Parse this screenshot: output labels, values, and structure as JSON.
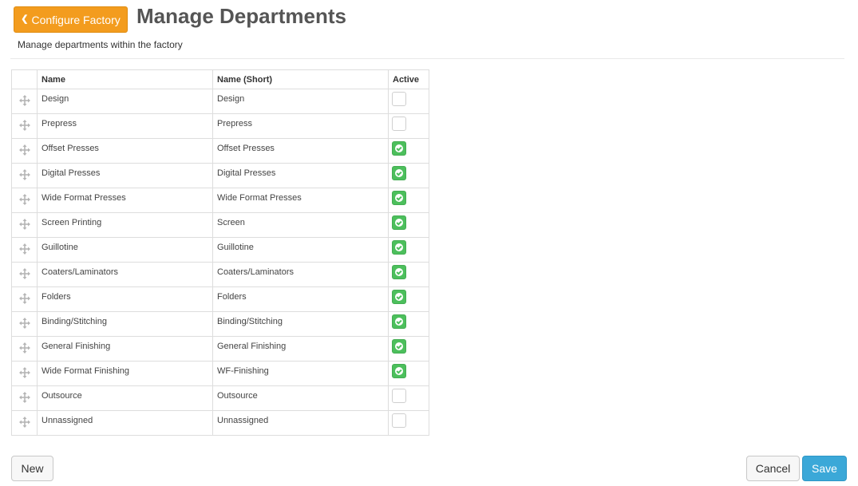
{
  "header": {
    "back_button_label": "Configure Factory",
    "title": "Manage Departments",
    "subtitle": "Manage departments within the factory"
  },
  "table": {
    "columns": {
      "name": "Name",
      "short": "Name (Short)",
      "active": "Active"
    },
    "rows": [
      {
        "name": "Design",
        "short": "Design",
        "active": false
      },
      {
        "name": "Prepress",
        "short": "Prepress",
        "active": false
      },
      {
        "name": "Offset Presses",
        "short": "Offset Presses",
        "active": true
      },
      {
        "name": "Digital Presses",
        "short": "Digital Presses",
        "active": true
      },
      {
        "name": "Wide Format Presses",
        "short": "Wide Format Presses",
        "active": true
      },
      {
        "name": "Screen Printing",
        "short": "Screen",
        "active": true
      },
      {
        "name": "Guillotine",
        "short": "Guillotine",
        "active": true
      },
      {
        "name": "Coaters/Laminators",
        "short": "Coaters/Laminators",
        "active": true
      },
      {
        "name": "Folders",
        "short": "Folders",
        "active": true
      },
      {
        "name": "Binding/Stitching",
        "short": "Binding/Stitching",
        "active": true
      },
      {
        "name": "General Finishing",
        "short": "General Finishing",
        "active": true
      },
      {
        "name": "Wide Format Finishing",
        "short": "WF-Finishing",
        "active": true
      },
      {
        "name": "Outsource",
        "short": "Outsource",
        "active": false
      },
      {
        "name": "Unnassigned",
        "short": "Unnassigned",
        "active": false
      }
    ]
  },
  "footer": {
    "new_label": "New",
    "cancel_label": "Cancel",
    "save_label": "Save"
  },
  "colors": {
    "accent_orange": "#f39c1e",
    "save_blue": "#3ba8d8",
    "active_green": "#4cbf5c"
  },
  "icons": {
    "back": "chevron-left-icon",
    "drag": "move-arrows-icon",
    "active": "check-circle-icon"
  }
}
